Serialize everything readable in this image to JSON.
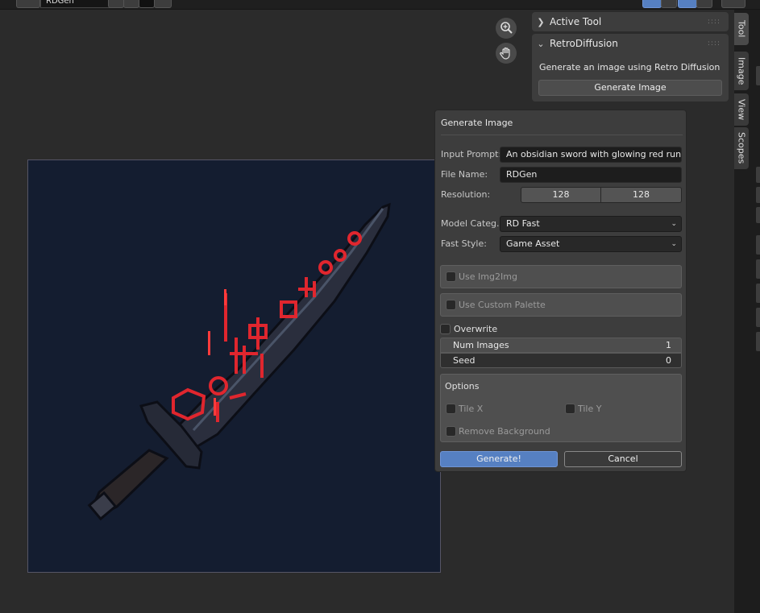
{
  "header": {
    "image_name": "RDGen"
  },
  "tabs": [
    {
      "label": "Tool"
    },
    {
      "label": "Image"
    },
    {
      "label": "View"
    },
    {
      "label": "Scopes"
    }
  ],
  "active_tool_panel": {
    "title": "Active Tool"
  },
  "retro_panel": {
    "title": "RetroDiffusion",
    "description": "Generate an image using Retro Diffusion",
    "generate_label": "Generate Image"
  },
  "dialog": {
    "title": "Generate Image",
    "input_prompt": {
      "label": "Input Prompt:",
      "value": "An obsidian sword with glowing red runes"
    },
    "file_name": {
      "label": "File Name:",
      "value": "RDGen"
    },
    "resolution": {
      "label": "Resolution:",
      "width": "128",
      "height": "128"
    },
    "model_category": {
      "label": "Model Categ...",
      "value": "RD Fast"
    },
    "fast_style": {
      "label": "Fast Style:",
      "value": "Game Asset"
    },
    "use_img2img": {
      "label": "Use Img2Img",
      "checked": false
    },
    "use_custom_palette": {
      "label": "Use Custom Palette",
      "checked": false
    },
    "overwrite": {
      "label": "Overwrite",
      "checked": false
    },
    "num_images": {
      "label": "Num Images",
      "value": "1"
    },
    "seed": {
      "label": "Seed",
      "value": "0"
    },
    "options": {
      "title": "Options",
      "tile_x": {
        "label": "Tile X",
        "checked": false
      },
      "tile_y": {
        "label": "Tile Y",
        "checked": false
      },
      "remove_background": {
        "label": "Remove Background",
        "checked": false
      }
    },
    "generate_button": "Generate!",
    "cancel_button": "Cancel"
  },
  "colors": {
    "accent": "#5680c2",
    "canvas_bg": "#141d30",
    "rune_red": "#e0262e"
  },
  "icons": [
    "zoom-in-icon",
    "hand-pan-icon",
    "chevron-right-icon",
    "chevron-down-icon",
    "grip-icon"
  ]
}
